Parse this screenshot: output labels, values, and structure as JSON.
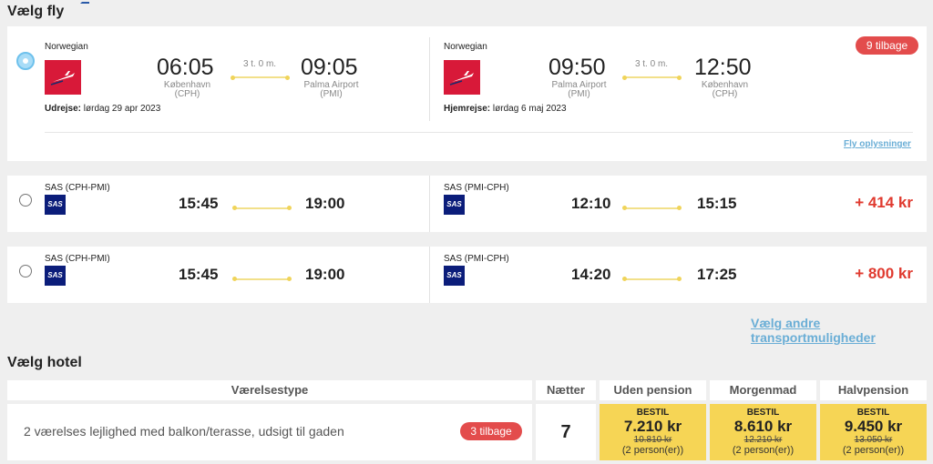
{
  "flights_section": {
    "title": "Vælg fly"
  },
  "selected_flight": {
    "outbound": {
      "airline": "Norwegian",
      "dep_time": "06:05",
      "dep_city": "København",
      "dep_code": "(CPH)",
      "duration": "3 t. 0 m.",
      "arr_time": "09:05",
      "arr_city": "Palma Airport",
      "arr_code": "(PMI)",
      "date_label": "Udrejse:",
      "date_value": " lørdag 29 apr 2023"
    },
    "inbound": {
      "airline": "Norwegian",
      "dep_time": "09:50",
      "dep_city": "Palma Airport",
      "dep_code": "(PMI)",
      "duration": "3 t. 0 m.",
      "arr_time": "12:50",
      "arr_city": "København",
      "arr_code": "(CPH)",
      "date_label": "Hjemrejse:",
      "date_value": " lørdag 6 maj 2023"
    },
    "badge": "9 tilbage",
    "info_link": "Fly oplysninger"
  },
  "alt_flights": [
    {
      "out_airline": "SAS (CPH-PMI)",
      "out_dep": "15:45",
      "out_arr": "19:00",
      "in_airline": "SAS (PMI-CPH)",
      "in_dep": "12:10",
      "in_arr": "15:15",
      "price": "+ 414 kr"
    },
    {
      "out_airline": "SAS (CPH-PMI)",
      "out_dep": "15:45",
      "out_arr": "19:00",
      "in_airline": "SAS (PMI-CPH)",
      "in_dep": "14:20",
      "in_arr": "17:25",
      "price": "+ 800 kr"
    }
  ],
  "sas_logo_text": "SAS",
  "transport_link": "Vælg andre transportmuligheder",
  "hotel_section": {
    "title": "Vælg hotel",
    "headers": {
      "room_type": "Værelsestype",
      "nights": "Nætter",
      "opt1": "Uden pension",
      "opt2": "Morgenmad",
      "opt3": "Halvpension"
    },
    "room": {
      "name": "2 værelses lejlighed med balkon/terasse, udsigt til gaden",
      "badge": "3 tilbage",
      "nights": "7",
      "prices": [
        {
          "book": "BESTIL",
          "price": "7.210 kr",
          "old": "10.810 kr",
          "persons": "(2 person(er))"
        },
        {
          "book": "BESTIL",
          "price": "8.610 kr",
          "old": "12.210 kr",
          "persons": "(2 person(er))"
        },
        {
          "book": "BESTIL",
          "price": "9.450 kr",
          "old": "13.050 kr",
          "persons": "(2 person(er))"
        }
      ]
    }
  },
  "colors": {
    "accent_yellow": "#f6d555",
    "badge_red": "#e34c4c",
    "price_red": "#e03a2f",
    "link_blue": "#6aaed6",
    "norwegian_red": "#d81939",
    "sas_blue": "#0b1d7a"
  }
}
